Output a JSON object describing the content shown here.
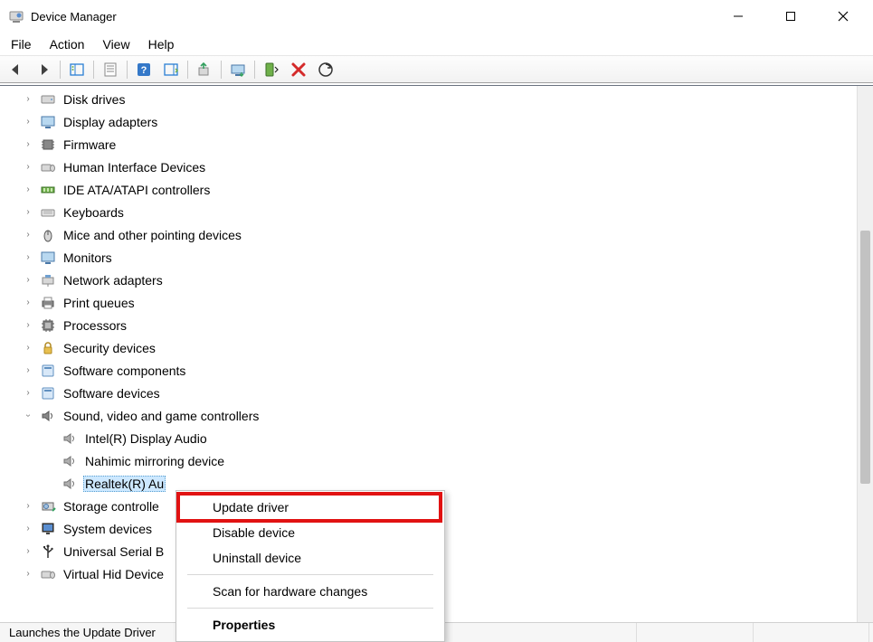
{
  "window": {
    "title": "Device Manager"
  },
  "menu": {
    "file": "File",
    "action": "Action",
    "view": "View",
    "help": "Help"
  },
  "tree": {
    "categories": [
      {
        "label": "Disk drives",
        "icon": "disk"
      },
      {
        "label": "Display adapters",
        "icon": "display"
      },
      {
        "label": "Firmware",
        "icon": "firmware"
      },
      {
        "label": "Human Interface Devices",
        "icon": "hid"
      },
      {
        "label": "IDE ATA/ATAPI controllers",
        "icon": "ide"
      },
      {
        "label": "Keyboards",
        "icon": "keyboard"
      },
      {
        "label": "Mice and other pointing devices",
        "icon": "mouse"
      },
      {
        "label": "Monitors",
        "icon": "monitor"
      },
      {
        "label": "Network adapters",
        "icon": "network"
      },
      {
        "label": "Print queues",
        "icon": "printer"
      },
      {
        "label": "Processors",
        "icon": "cpu"
      },
      {
        "label": "Security devices",
        "icon": "security"
      },
      {
        "label": "Software components",
        "icon": "software"
      },
      {
        "label": "Software devices",
        "icon": "software"
      },
      {
        "label": "Sound, video and game controllers",
        "icon": "sound",
        "expanded": true,
        "children": [
          {
            "label": "Intel(R) Display Audio"
          },
          {
            "label": "Nahimic mirroring device"
          },
          {
            "label": "Realtek(R) Audio",
            "selected": true,
            "truncated": "Realtek(R) Au"
          }
        ]
      },
      {
        "label": "Storage controllers",
        "icon": "storage",
        "truncated": "Storage controlle"
      },
      {
        "label": "System devices",
        "icon": "system",
        "truncated": "System devices"
      },
      {
        "label": "Universal Serial Bus controllers",
        "icon": "usb",
        "truncated": "Universal Serial B"
      },
      {
        "label": "Virtual Hid Devices",
        "icon": "virtual",
        "truncated": "Virtual Hid Device"
      }
    ]
  },
  "context_menu": {
    "update_driver": "Update driver",
    "disable_device": "Disable device",
    "uninstall_device": "Uninstall device",
    "scan_hardware": "Scan for hardware changes",
    "properties": "Properties"
  },
  "status": {
    "text": "Launches the Update Driver"
  }
}
